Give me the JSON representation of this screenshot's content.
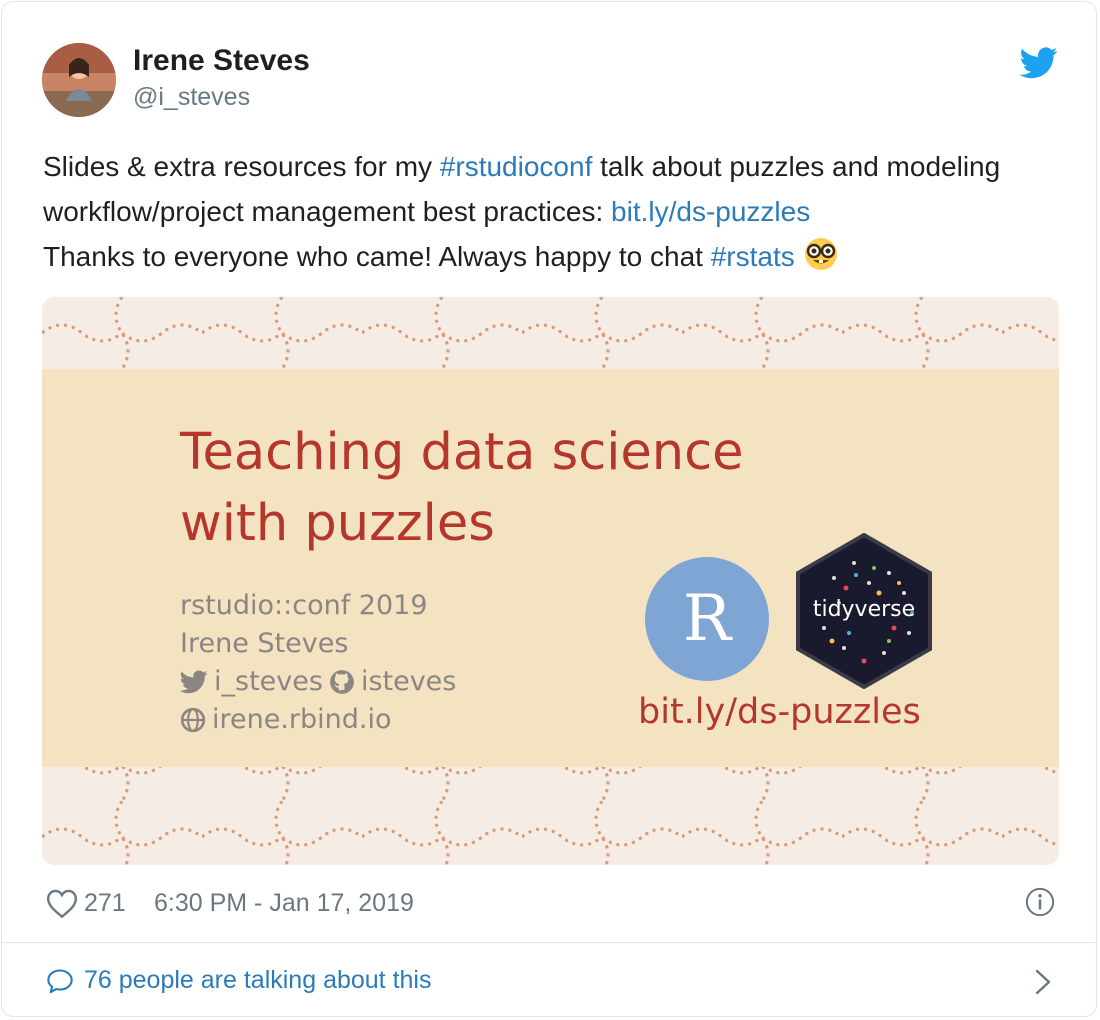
{
  "author": {
    "name": "Irene Steves",
    "handle": "@i_steves"
  },
  "tweet": {
    "parts": [
      "Slides & extra resources for my ",
      "#rstudioconf",
      " talk about puzzles and modeling workflow/project management best practices: ",
      "bit.ly/ds-puzzles",
      " Thanks to everyone who came!  Always happy to chat ",
      "#rstats",
      " "
    ],
    "emoji": "nerd-face"
  },
  "media": {
    "title_line1": "Teaching data science",
    "title_line2": "with puzzles",
    "conf": "rstudio::conf 2019",
    "presenter": "Irene Steves",
    "twitter": "i_steves",
    "github": "isteves",
    "website": "irene.rbind.io",
    "r_logo": "R",
    "tidyverse_logo": "tidyverse",
    "link": "bit.ly/ds-puzzles"
  },
  "footer": {
    "likes": "271",
    "timestamp": "6:30 PM - Jan 17, 2019"
  },
  "discussion": {
    "label": "76 people are talking about this"
  },
  "colors": {
    "link": "#2b7bb9",
    "slide_title": "#b5362b",
    "slide_bg": "#f3e3c1"
  }
}
